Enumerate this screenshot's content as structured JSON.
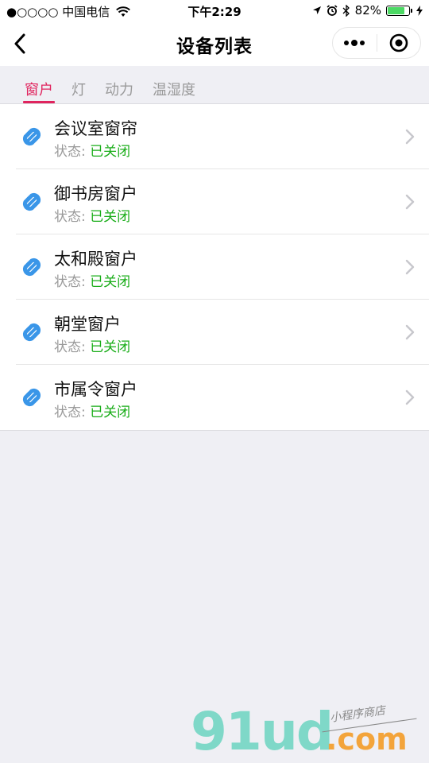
{
  "status_bar": {
    "carrier": "●○○○○ 中国电信",
    "time": "下午2:29",
    "battery": "82%",
    "battery_level": 0.82,
    "icons": [
      "signal-icon",
      "wifi-icon",
      "location-arrow-icon",
      "alarm-icon",
      "bluetooth-icon",
      "battery-icon",
      "charging-icon"
    ]
  },
  "nav": {
    "title": "设备列表",
    "back_icon": "back-arrow-icon",
    "more_icon": "more-dots-icon",
    "close_icon": "target-close-icon"
  },
  "tabs": [
    {
      "label": "窗户",
      "active": true
    },
    {
      "label": "灯",
      "active": false
    },
    {
      "label": "动力",
      "active": false
    },
    {
      "label": "温湿度",
      "active": false
    }
  ],
  "devices": [
    {
      "name": "会议室窗帘",
      "status_label": "状态:",
      "status_value": "已关闭"
    },
    {
      "name": "御书房窗户",
      "status_label": "状态:",
      "status_value": "已关闭"
    },
    {
      "name": "太和殿窗户",
      "status_label": "状态:",
      "status_value": "已关闭"
    },
    {
      "name": "朝堂窗户",
      "status_label": "状态:",
      "status_value": "已关闭"
    },
    {
      "name": "市属令窗户",
      "status_label": "状态:",
      "status_value": "已关闭"
    }
  ],
  "watermark": {
    "main": "91ud",
    "dotcom": ".com",
    "tagline": "小程序商店"
  },
  "colors": {
    "accent": "#e0245e",
    "status_ok": "#1aad19",
    "link_icon": "#3a96e8",
    "muted": "#9a9a9a",
    "page_bg": "#efeff4"
  }
}
